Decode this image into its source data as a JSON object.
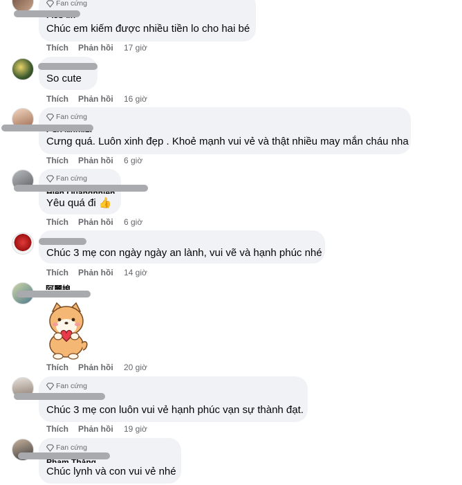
{
  "labels": {
    "fan": "Fan cứng",
    "like": "Thích",
    "reply": "Phản hồi"
  },
  "comments": [
    {
      "name_fragment": "Lisa Vu",
      "text": "Chúc em kiếm được nhiều tiền lo cho hai bé",
      "time": "17 giờ",
      "fan": true
    },
    {
      "name_fragment": "",
      "text": "So cute",
      "time": "16 giờ",
      "fan": false
    },
    {
      "name_fragment": "Cao Nguyệt",
      "text": "Cưng quá. Luôn xinh đẹp . Khoẻ mạnh vui vẻ và thật nhiều may mắn cháu nha",
      "time": "6 giờ",
      "fan": true
    },
    {
      "name_fragment": "Hiền Quangnhiên",
      "text": "Yêu quá đi 👍",
      "time": "6 giờ",
      "fan": true
    },
    {
      "name_fragment": "",
      "text": "Chúc 3 mẹ con ngày ngày an lành, vui vẽ và hạnh phúc nhé",
      "time": "14 giờ",
      "fan": false
    },
    {
      "name_fragment": "阿麗娘",
      "text": "",
      "sticker": "shiba-dog-heart-sticker",
      "time": "20 giờ",
      "fan": false
    },
    {
      "name_fragment": "",
      "text": "Chúc 3 mẹ con luôn vui vẻ hạnh phúc vạn sự thành đạt.",
      "time": "19 giờ",
      "fan": true
    },
    {
      "name_fragment": "Phạm Thắng",
      "text": "Chúc lynh và con vui vẻ nhé",
      "time": "",
      "fan": true
    }
  ],
  "colors": {
    "bubble": "#f0f2f5",
    "meta": "#65676b",
    "text": "#050505"
  }
}
